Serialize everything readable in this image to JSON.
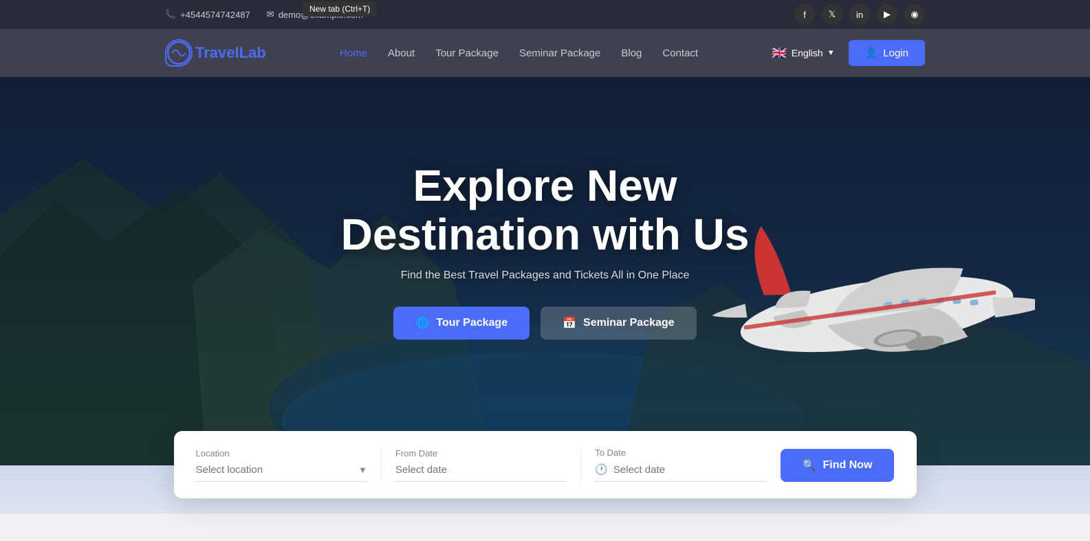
{
  "topbar": {
    "phone": "+4544574742487",
    "email": "demo@example.com",
    "phone_icon": "📞",
    "email_icon": "✉",
    "tooltip": "New tab (Ctrl+T)"
  },
  "social": [
    {
      "name": "facebook",
      "icon": "f"
    },
    {
      "name": "twitter",
      "icon": "t"
    },
    {
      "name": "linkedin",
      "icon": "in"
    },
    {
      "name": "youtube",
      "icon": "▶"
    },
    {
      "name": "instagram",
      "icon": "◉"
    }
  ],
  "navbar": {
    "logo_travel": "Travel",
    "logo_lab": "Lab",
    "links": [
      {
        "label": "Home",
        "active": true
      },
      {
        "label": "About",
        "active": false
      },
      {
        "label": "Tour Package",
        "active": false
      },
      {
        "label": "Seminar Package",
        "active": false
      },
      {
        "label": "Blog",
        "active": false
      },
      {
        "label": "Contact",
        "active": false
      }
    ],
    "language": "English",
    "login_label": "Login"
  },
  "hero": {
    "title_line1": "Explore New",
    "title_line2": "Destination with Us",
    "subtitle": "Find the Best Travel Packages and Tickets All in One Place",
    "btn_tour": "Tour Package",
    "btn_seminar": "Seminar Package"
  },
  "search": {
    "location_label": "Location",
    "location_placeholder": "Select location",
    "from_date_label": "From Date",
    "from_date_placeholder": "Select date",
    "to_date_label": "To Date",
    "to_date_placeholder": "Select date",
    "find_btn": "Find Now"
  }
}
